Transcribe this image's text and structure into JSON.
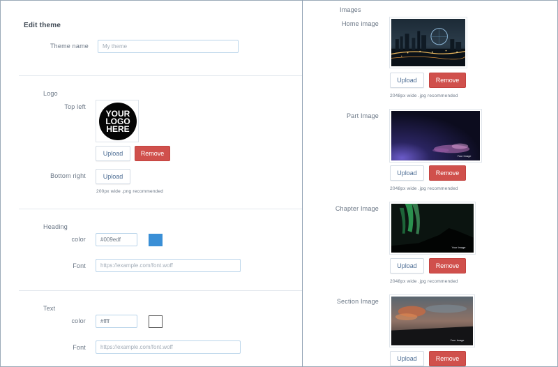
{
  "left": {
    "title": "Edit theme",
    "theme_name_label": "Theme name",
    "theme_name_placeholder": "My theme",
    "logo": {
      "section_label": "Logo",
      "top_left_label": "Top left",
      "logo_text_lines": [
        "YOUR",
        "LOGO",
        "HERE"
      ],
      "upload_label": "Upload",
      "remove_label": "Remove",
      "bottom_right_label": "Bottom right",
      "bottom_upload_label": "Upload",
      "note": "200px wide .png recommended"
    },
    "heading": {
      "section_label": "Heading",
      "color_label": "color",
      "color_value": "#009edf",
      "swatch_color": "#3a8fd6",
      "font_label": "Font",
      "font_placeholder": "https://example.com/font.woff"
    },
    "text": {
      "section_label": "Text",
      "color_label": "color",
      "color_value": "#ffff",
      "swatch_color": "#ffffff",
      "font_label": "Font",
      "font_placeholder": "https://example.com/font.woff"
    }
  },
  "right": {
    "section_label": "Images",
    "home": {
      "label": "Home image",
      "upload_label": "Upload",
      "remove_label": "Remove",
      "note": "2048px wide .jpg recommended"
    },
    "part": {
      "label": "Part Image",
      "upload_label": "Upload",
      "remove_label": "Remove",
      "note": "2048px wide .jpg recommended",
      "caption": "Your Image"
    },
    "chapter": {
      "label": "Chapter Image",
      "upload_label": "Upload",
      "remove_label": "Remove",
      "note": "2048px wide .jpg recommended",
      "caption": "Your Image"
    },
    "section": {
      "label": "Section Image",
      "upload_label": "Upload",
      "remove_label": "Remove",
      "caption": "Your Image"
    }
  },
  "colors": {
    "remove_button": "#d0504c",
    "upload_text": "#4d6d94",
    "input_border": "#b9d4ea"
  }
}
